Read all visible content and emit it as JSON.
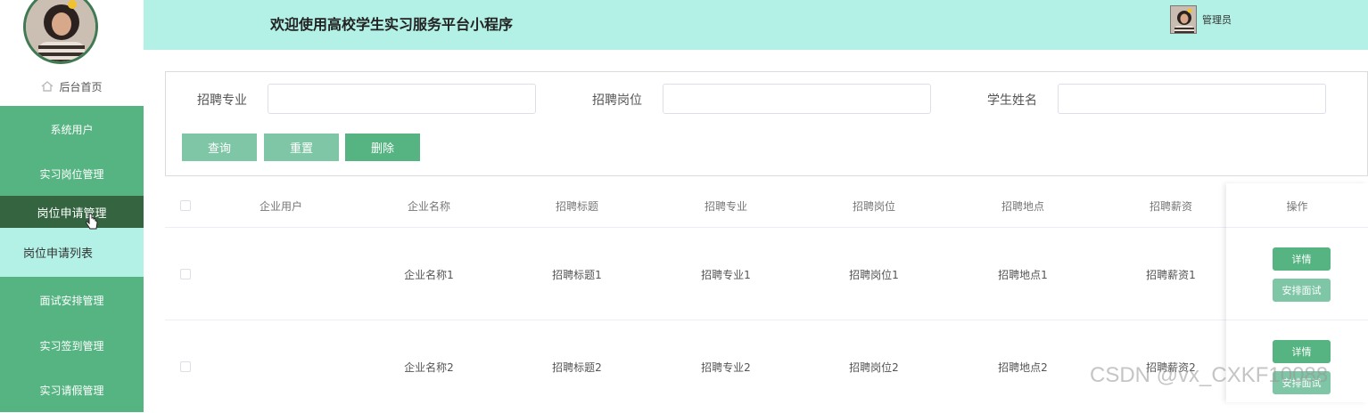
{
  "header": {
    "title": "欢迎使用高校学生实习服务平台小程序",
    "user_name": "管理员"
  },
  "sidebar": {
    "home_label": "后台首页",
    "items": [
      {
        "label": "系统用户"
      },
      {
        "label": "实习岗位管理"
      },
      {
        "label": "岗位申请管理"
      },
      {
        "label": "岗位申请列表"
      },
      {
        "label": "面试安排管理"
      },
      {
        "label": "实习签到管理"
      },
      {
        "label": "实习请假管理"
      }
    ]
  },
  "search": {
    "fields": [
      {
        "label": "招聘专业",
        "value": ""
      },
      {
        "label": "招聘岗位",
        "value": ""
      },
      {
        "label": "学生姓名",
        "value": ""
      }
    ],
    "buttons": {
      "query": "查询",
      "reset": "重置",
      "delete": "删除"
    }
  },
  "table": {
    "columns": [
      "企业用户",
      "企业名称",
      "招聘标题",
      "招聘专业",
      "招聘岗位",
      "招聘地点",
      "招聘薪资",
      "操作"
    ],
    "rows": [
      {
        "user": "",
        "company": "企业名称1",
        "title": "招聘标题1",
        "major": "招聘专业1",
        "position": "招聘岗位1",
        "location": "招聘地点1",
        "salary": "招聘薪资1"
      },
      {
        "user": "",
        "company": "企业名称2",
        "title": "招聘标题2",
        "major": "招聘专业2",
        "position": "招聘岗位2",
        "location": "招聘地点2",
        "salary": "招聘薪资2"
      }
    ],
    "actions": {
      "detail": "详情",
      "arrange": "安排面试"
    }
  },
  "watermark": "CSDN @vx_CXKF10088",
  "colors": {
    "menu": "#55b482",
    "menu_active": "#356540",
    "header": "#b3f0e5",
    "button_light": "#7fc6a6"
  }
}
